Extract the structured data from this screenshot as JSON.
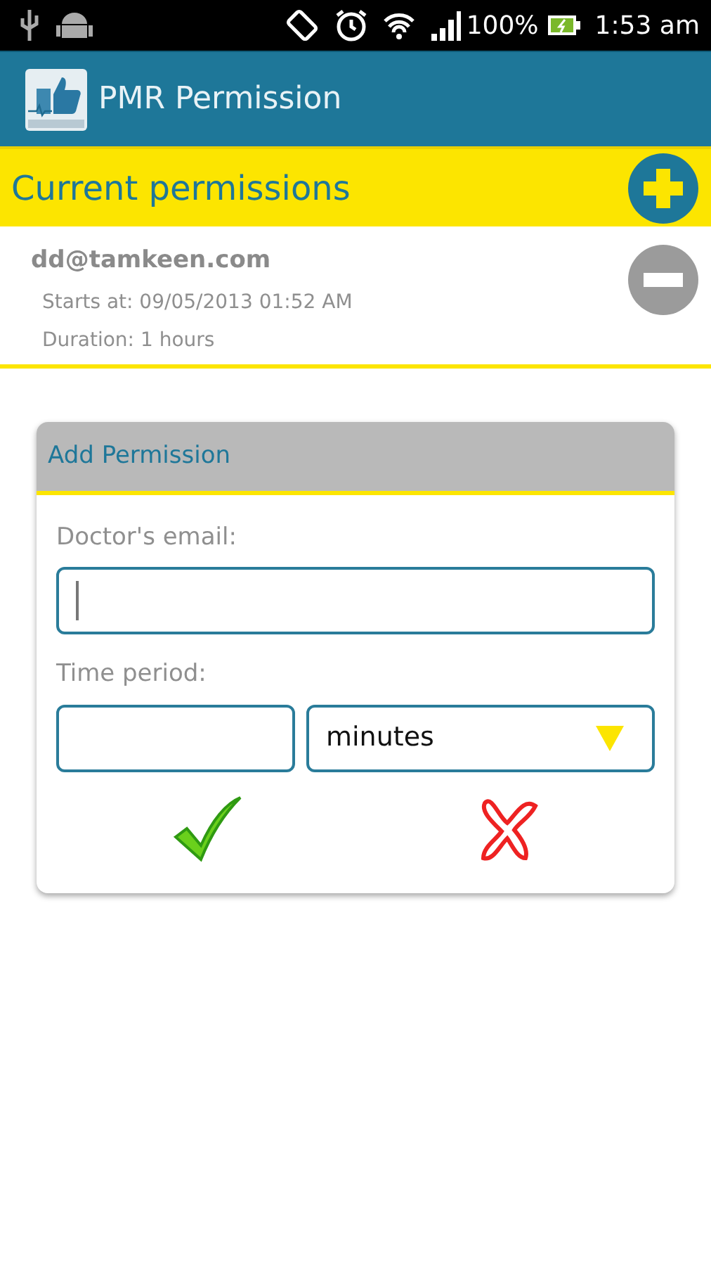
{
  "status_bar": {
    "battery": "100%",
    "time": "1:53 am"
  },
  "app_bar": {
    "title": "PMR Permission"
  },
  "current_permissions": {
    "title": "Current permissions",
    "items": [
      {
        "email": "dd@tamkeen.com",
        "starts": "Starts at: 09/05/2013 01:52 AM",
        "duration": "Duration: 1 hours"
      }
    ]
  },
  "add_permission": {
    "title": "Add Permission",
    "email_label": "Doctor's email:",
    "email_focused": true,
    "period_label": "Time period:",
    "unit": "minutes"
  }
}
